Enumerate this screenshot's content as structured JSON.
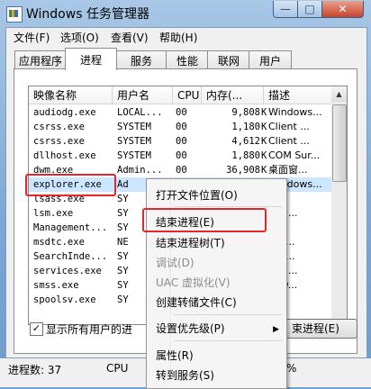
{
  "window": {
    "title": "Windows 任务管理器"
  },
  "titlebar_buttons": {
    "minimize": "—",
    "maximize": "□",
    "close": "✕"
  },
  "menubar": [
    "文件(F)",
    "选项(O)",
    "查看(V)",
    "帮助(H)"
  ],
  "tabs": [
    "应用程序",
    "进程",
    "服务",
    "性能",
    "联网",
    "用户"
  ],
  "active_tab": "进程",
  "columns": [
    "映像名称",
    "用户名",
    "CPU",
    "内存(...",
    "描述"
  ],
  "processes": [
    {
      "name": "audiodg.exe",
      "user": "LOCAL...",
      "cpu": "00",
      "mem": "9,808",
      "unit": "K",
      "desc": "Windows..."
    },
    {
      "name": "csrss.exe",
      "user": "SYSTEM",
      "cpu": "00",
      "mem": "1,180",
      "unit": "K",
      "desc": "Client ..."
    },
    {
      "name": "csrss.exe",
      "user": "SYSTEM",
      "cpu": "00",
      "mem": "4,612",
      "unit": "K",
      "desc": "Client ..."
    },
    {
      "name": "dllhost.exe",
      "user": "SYSTEM",
      "cpu": "00",
      "mem": "1,880",
      "unit": "K",
      "desc": "COM Sur..."
    },
    {
      "name": "dwm.exe",
      "user": "Admin...",
      "cpu": "00",
      "mem": "36,908",
      "unit": "K",
      "desc": "桌面窗..."
    },
    {
      "name": "explorer.exe",
      "user": "Ad",
      "cpu": "",
      "mem": "",
      "unit": "",
      "desc": "Windows..."
    },
    {
      "name": "lsass.exe",
      "user": "SY",
      "cpu": "",
      "mem": "",
      "unit": "",
      "desc": "."
    },
    {
      "name": "lsm.exe",
      "user": "SY",
      "cpu": "",
      "mem": "",
      "unit": "",
      "desc": "话会..."
    },
    {
      "name": "Management...",
      "user": "SY",
      "cpu": "",
      "mem": "",
      "unit": "",
      "desc": "..."
    },
    {
      "name": "msdtc.exe",
      "user": "NE",
      "cpu": "",
      "mem": "",
      "unit": "",
      "desc": "oso..."
    },
    {
      "name": "SearchInde...",
      "user": "SY",
      "cpu": "",
      "mem": "",
      "unit": "",
      "desc": "oso..."
    },
    {
      "name": "services.exe",
      "user": "SY",
      "cpu": "",
      "mem": "",
      "unit": "",
      "desc": "务和..."
    },
    {
      "name": "smss.exe",
      "user": "SY",
      "cpu": "",
      "mem": "",
      "unit": "",
      "desc": "dow..."
    },
    {
      "name": "spoolsv.exe",
      "user": "SY",
      "cpu": "",
      "mem": "",
      "unit": "",
      "desc": "处..."
    }
  ],
  "selected_process": "explorer.exe",
  "show_all_users_label": "显示所有用户的进",
  "end_process_button": "束进程(E)",
  "status": {
    "process_count": "进程数: 37",
    "cpu_label": "CPU",
    "tail": "%"
  },
  "context_menu": {
    "items": [
      {
        "label": "打开文件位置(O)",
        "disabled": false
      },
      {
        "label": "结束进程(E)",
        "disabled": false
      },
      {
        "label": "结束进程树(T)",
        "disabled": false
      },
      {
        "label": "调试(D)",
        "disabled": true
      },
      {
        "label": "UAC 虚拟化(V)",
        "disabled": true
      },
      {
        "label": "创建转储文件(C)",
        "disabled": false
      },
      {
        "label": "设置优先级(P)",
        "disabled": false
      },
      {
        "label": "属性(R)",
        "disabled": false
      },
      {
        "label": "转到服务(S)",
        "disabled": false
      }
    ],
    "submenu_arrow": "▶"
  },
  "colors": {
    "highlight": "#e5262a",
    "selection": "#cde6ff"
  }
}
